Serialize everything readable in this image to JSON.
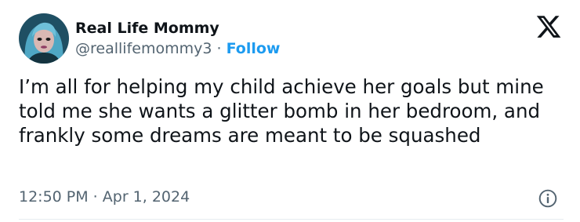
{
  "tweet": {
    "display_name": "Real Life Mommy",
    "handle": "@reallifemommy3",
    "separator": " · ",
    "follow_label": "Follow",
    "text": "I’m all for helping my child achieve her goals but mine told me she wants a glitter bomb in her bedroom, and frankly some dreams are meant to be squashed",
    "timestamp": "12:50 PM · Apr 1, 2024"
  },
  "icons": {
    "brand": "x-logo-icon",
    "info": "info-icon",
    "avatar": "avatar-image"
  },
  "colors": {
    "text": "#0f1419",
    "secondary": "#536471",
    "link": "#1d9bf0",
    "avatar_bg": "#1f4f63",
    "avatar_hair": "#4fa7c4"
  }
}
